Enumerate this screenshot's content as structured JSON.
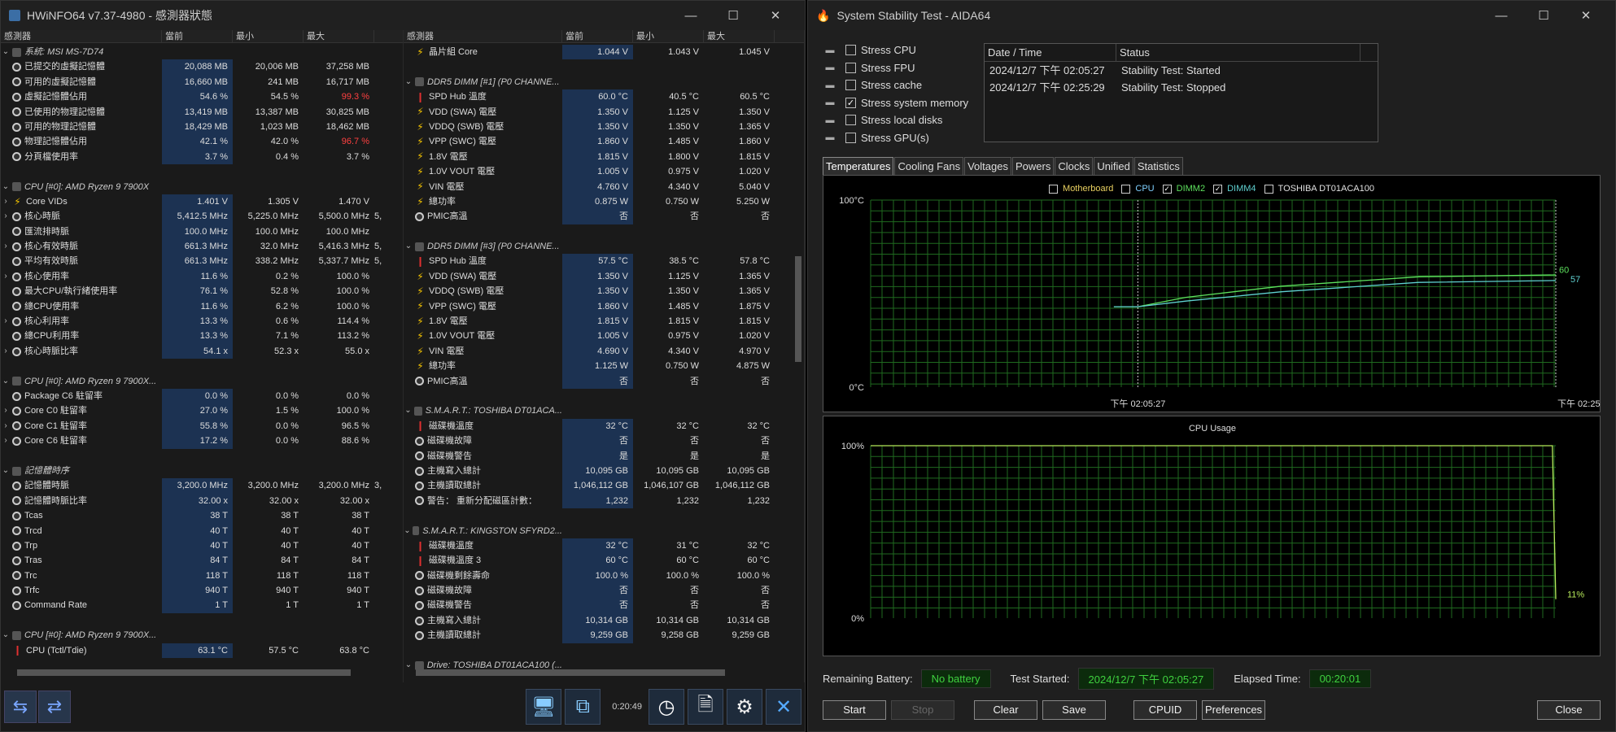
{
  "hwinfo": {
    "title": "HWiNFO64 v7.37-4980 - 感測器狀態",
    "columns": [
      "感測器",
      "當前",
      "最小",
      "最大"
    ],
    "left_rows": [
      {
        "type": "group",
        "name": "系統: MSI MS-7D74"
      },
      {
        "type": "row",
        "icon": "clock",
        "name": "已提交的虛擬記憶體",
        "cur": "20,088 MB",
        "min": "20,006 MB",
        "max": "37,258 MB"
      },
      {
        "type": "row",
        "icon": "clock",
        "name": "可用的虛擬記憶體",
        "cur": "16,660 MB",
        "min": "241 MB",
        "max": "16,717 MB"
      },
      {
        "type": "row",
        "icon": "clock",
        "name": "虛擬記憶體佔用",
        "cur": "54.6 %",
        "min": "54.5 %",
        "max": "99.3 %",
        "maxRed": true
      },
      {
        "type": "row",
        "icon": "clock",
        "name": "已使用的物理記憶體",
        "cur": "13,419 MB",
        "min": "13,387 MB",
        "max": "30,825 MB"
      },
      {
        "type": "row",
        "icon": "clock",
        "name": "可用的物理記憶體",
        "cur": "18,429 MB",
        "min": "1,023 MB",
        "max": "18,462 MB"
      },
      {
        "type": "row",
        "icon": "clock",
        "name": "物理記憶體佔用",
        "cur": "42.1 %",
        "min": "42.0 %",
        "max": "96.7 %",
        "maxRed": true
      },
      {
        "type": "row",
        "icon": "clock",
        "name": "分頁檔使用率",
        "cur": "3.7 %",
        "min": "0.4 %",
        "max": "3.7 %"
      },
      {
        "type": "blank"
      },
      {
        "type": "group",
        "name": "CPU [#0]: AMD Ryzen 9 7900X"
      },
      {
        "type": "row",
        "icon": "bolt",
        "exp": true,
        "name": "Core VIDs",
        "cur": "1.401 V",
        "min": "1.305 V",
        "max": "1.470 V"
      },
      {
        "type": "row",
        "icon": "clock",
        "exp": true,
        "name": "核心時脈",
        "cur": "5,412.5 MHz",
        "min": "5,225.0 MHz",
        "max": "5,500.0 MHz",
        "extra": "5,"
      },
      {
        "type": "row",
        "icon": "clock",
        "name": "匯流排時脈",
        "cur": "100.0 MHz",
        "min": "100.0 MHz",
        "max": "100.0 MHz"
      },
      {
        "type": "row",
        "icon": "clock",
        "exp": true,
        "name": "核心有效時脈",
        "cur": "661.3 MHz",
        "min": "32.0 MHz",
        "max": "5,416.3 MHz",
        "extra": "5,"
      },
      {
        "type": "row",
        "icon": "clock",
        "name": "平均有效時脈",
        "cur": "661.3 MHz",
        "min": "338.2 MHz",
        "max": "5,337.7 MHz",
        "extra": "5,"
      },
      {
        "type": "row",
        "icon": "clock",
        "exp": true,
        "name": "核心使用率",
        "cur": "11.6 %",
        "min": "0.2 %",
        "max": "100.0 %"
      },
      {
        "type": "row",
        "icon": "clock",
        "name": "最大CPU/執行緒使用率",
        "cur": "76.1 %",
        "min": "52.8 %",
        "max": "100.0 %"
      },
      {
        "type": "row",
        "icon": "clock",
        "name": "總CPU使用率",
        "cur": "11.6 %",
        "min": "6.2 %",
        "max": "100.0 %"
      },
      {
        "type": "row",
        "icon": "clock",
        "exp": true,
        "name": "核心利用率",
        "cur": "13.3 %",
        "min": "0.6 %",
        "max": "114.4 %"
      },
      {
        "type": "row",
        "icon": "clock",
        "name": "總CPU利用率",
        "cur": "13.3 %",
        "min": "7.1 %",
        "max": "113.2 %"
      },
      {
        "type": "row",
        "icon": "clock",
        "exp": true,
        "name": "核心時脈比率",
        "cur": "54.1 x",
        "min": "52.3 x",
        "max": "55.0 x"
      },
      {
        "type": "blank"
      },
      {
        "type": "group",
        "name": "CPU [#0]: AMD Ryzen 9 7900X..."
      },
      {
        "type": "row",
        "icon": "clock",
        "name": "Package C6 駐留率",
        "cur": "0.0 %",
        "min": "0.0 %",
        "max": "0.0 %"
      },
      {
        "type": "row",
        "icon": "clock",
        "exp": true,
        "name": "Core C0 駐留率",
        "cur": "27.0 %",
        "min": "1.5 %",
        "max": "100.0 %"
      },
      {
        "type": "row",
        "icon": "clock",
        "exp": true,
        "name": "Core C1 駐留率",
        "cur": "55.8 %",
        "min": "0.0 %",
        "max": "96.5 %"
      },
      {
        "type": "row",
        "icon": "clock",
        "exp": true,
        "name": "Core C6 駐留率",
        "cur": "17.2 %",
        "min": "0.0 %",
        "max": "88.6 %"
      },
      {
        "type": "blank"
      },
      {
        "type": "group",
        "name": "記憶體時序"
      },
      {
        "type": "row",
        "icon": "clock",
        "name": "記憶體時脈",
        "cur": "3,200.0 MHz",
        "min": "3,200.0 MHz",
        "max": "3,200.0 MHz",
        "extra": "3,"
      },
      {
        "type": "row",
        "icon": "clock",
        "name": "記憶體時脈比率",
        "cur": "32.00 x",
        "min": "32.00 x",
        "max": "32.00 x"
      },
      {
        "type": "row",
        "icon": "clock",
        "name": "Tcas",
        "cur": "38 T",
        "min": "38 T",
        "max": "38 T"
      },
      {
        "type": "row",
        "icon": "clock",
        "name": "Trcd",
        "cur": "40 T",
        "min": "40 T",
        "max": "40 T"
      },
      {
        "type": "row",
        "icon": "clock",
        "name": "Trp",
        "cur": "40 T",
        "min": "40 T",
        "max": "40 T"
      },
      {
        "type": "row",
        "icon": "clock",
        "name": "Tras",
        "cur": "84 T",
        "min": "84 T",
        "max": "84 T"
      },
      {
        "type": "row",
        "icon": "clock",
        "name": "Trc",
        "cur": "118 T",
        "min": "118 T",
        "max": "118 T"
      },
      {
        "type": "row",
        "icon": "clock",
        "name": "Trfc",
        "cur": "940 T",
        "min": "940 T",
        "max": "940 T"
      },
      {
        "type": "row",
        "icon": "clock",
        "name": "Command Rate",
        "cur": "1 T",
        "min": "1 T",
        "max": "1 T"
      },
      {
        "type": "blank"
      },
      {
        "type": "group",
        "name": "CPU [#0]: AMD Ryzen 9 7900X..."
      },
      {
        "type": "row",
        "icon": "therm",
        "name": "CPU (Tctl/Tdie)",
        "cur": "63.1 °C",
        "min": "57.5 °C",
        "max": "63.8 °C"
      }
    ],
    "right_rows": [
      {
        "type": "row",
        "icon": "bolt",
        "name": "晶片組 Core",
        "cur": "1.044 V",
        "min": "1.043 V",
        "max": "1.045 V"
      },
      {
        "type": "blank"
      },
      {
        "type": "group",
        "name": "DDR5 DIMM [#1] (P0 CHANNE..."
      },
      {
        "type": "row",
        "icon": "therm",
        "name": "SPD Hub 溫度",
        "cur": "60.0 °C",
        "min": "40.5 °C",
        "max": "60.5 °C"
      },
      {
        "type": "row",
        "icon": "bolt",
        "name": "VDD (SWA) 電壓",
        "cur": "1.350 V",
        "min": "1.125 V",
        "max": "1.350 V"
      },
      {
        "type": "row",
        "icon": "bolt",
        "name": "VDDQ (SWB) 電壓",
        "cur": "1.350 V",
        "min": "1.350 V",
        "max": "1.365 V"
      },
      {
        "type": "row",
        "icon": "bolt",
        "name": "VPP (SWC) 電壓",
        "cur": "1.860 V",
        "min": "1.485 V",
        "max": "1.860 V"
      },
      {
        "type": "row",
        "icon": "bolt",
        "name": "1.8V 電壓",
        "cur": "1.815 V",
        "min": "1.800 V",
        "max": "1.815 V"
      },
      {
        "type": "row",
        "icon": "bolt",
        "name": "1.0V VOUT 電壓",
        "cur": "1.005 V",
        "min": "0.975 V",
        "max": "1.020 V"
      },
      {
        "type": "row",
        "icon": "bolt",
        "name": "VIN 電壓",
        "cur": "4.760 V",
        "min": "4.340 V",
        "max": "5.040 V"
      },
      {
        "type": "row",
        "icon": "bolt",
        "name": "總功率",
        "cur": "0.875 W",
        "min": "0.750 W",
        "max": "5.250 W"
      },
      {
        "type": "row",
        "icon": "clock",
        "name": "PMIC高溫",
        "cur": "否",
        "min": "否",
        "max": "否"
      },
      {
        "type": "blank"
      },
      {
        "type": "group",
        "name": "DDR5 DIMM [#3] (P0 CHANNE..."
      },
      {
        "type": "row",
        "icon": "therm",
        "name": "SPD Hub 溫度",
        "cur": "57.5 °C",
        "min": "38.5 °C",
        "max": "57.8 °C"
      },
      {
        "type": "row",
        "icon": "bolt",
        "name": "VDD (SWA) 電壓",
        "cur": "1.350 V",
        "min": "1.125 V",
        "max": "1.365 V"
      },
      {
        "type": "row",
        "icon": "bolt",
        "name": "VDDQ (SWB) 電壓",
        "cur": "1.350 V",
        "min": "1.350 V",
        "max": "1.365 V"
      },
      {
        "type": "row",
        "icon": "bolt",
        "name": "VPP (SWC) 電壓",
        "cur": "1.860 V",
        "min": "1.485 V",
        "max": "1.875 V"
      },
      {
        "type": "row",
        "icon": "bolt",
        "name": "1.8V 電壓",
        "cur": "1.815 V",
        "min": "1.815 V",
        "max": "1.815 V"
      },
      {
        "type": "row",
        "icon": "bolt",
        "name": "1.0V VOUT 電壓",
        "cur": "1.005 V",
        "min": "0.975 V",
        "max": "1.020 V"
      },
      {
        "type": "row",
        "icon": "bolt",
        "name": "VIN 電壓",
        "cur": "4.690 V",
        "min": "4.340 V",
        "max": "4.970 V"
      },
      {
        "type": "row",
        "icon": "bolt",
        "name": "總功率",
        "cur": "1.125 W",
        "min": "0.750 W",
        "max": "4.875 W"
      },
      {
        "type": "row",
        "icon": "clock",
        "name": "PMIC高溫",
        "cur": "否",
        "min": "否",
        "max": "否"
      },
      {
        "type": "blank"
      },
      {
        "type": "group",
        "name": "S.M.A.R.T.: TOSHIBA DT01ACA..."
      },
      {
        "type": "row",
        "icon": "therm",
        "name": "磁碟機溫度",
        "cur": "32 °C",
        "min": "32 °C",
        "max": "32 °C"
      },
      {
        "type": "row",
        "icon": "clock",
        "name": "磁碟機故障",
        "cur": "否",
        "min": "否",
        "max": "否"
      },
      {
        "type": "row",
        "icon": "clock",
        "name": "磁碟機警告",
        "cur": "是",
        "min": "是",
        "max": "是"
      },
      {
        "type": "row",
        "icon": "clock",
        "name": "主機寫入總計",
        "cur": "10,095 GB",
        "min": "10,095 GB",
        "max": "10,095 GB"
      },
      {
        "type": "row",
        "icon": "clock",
        "name": "主機讀取總計",
        "cur": "1,046,112 GB",
        "min": "1,046,107 GB",
        "max": "1,046,112 GB"
      },
      {
        "type": "row",
        "icon": "clock",
        "name": "警告： 重新分配磁區計數：",
        "cur": "1,232",
        "min": "1,232",
        "max": "1,232"
      },
      {
        "type": "blank"
      },
      {
        "type": "group",
        "name": "S.M.A.R.T.: KINGSTON SFYRD2..."
      },
      {
        "type": "row",
        "icon": "therm",
        "name": "磁碟機溫度",
        "cur": "32 °C",
        "min": "31 °C",
        "max": "32 °C"
      },
      {
        "type": "row",
        "icon": "therm",
        "name": "磁碟機溫度 3",
        "cur": "60 °C",
        "min": "60 °C",
        "max": "60 °C"
      },
      {
        "type": "row",
        "icon": "clock",
        "name": "磁碟機剩餘壽命",
        "cur": "100.0 %",
        "min": "100.0 %",
        "max": "100.0 %"
      },
      {
        "type": "row",
        "icon": "clock",
        "name": "磁碟機故障",
        "cur": "否",
        "min": "否",
        "max": "否"
      },
      {
        "type": "row",
        "icon": "clock",
        "name": "磁碟機警告",
        "cur": "否",
        "min": "否",
        "max": "否"
      },
      {
        "type": "row",
        "icon": "clock",
        "name": "主機寫入總計",
        "cur": "10,314 GB",
        "min": "10,314 GB",
        "max": "10,314 GB"
      },
      {
        "type": "row",
        "icon": "clock",
        "name": "主機讀取總計",
        "cur": "9,259 GB",
        "min": "9,258 GB",
        "max": "9,259 GB"
      },
      {
        "type": "blank"
      },
      {
        "type": "group",
        "name": "Drive: TOSHIBA DT01ACA100 (..."
      }
    ],
    "time": "0:20:49"
  },
  "aida": {
    "title": "System Stability Test - AIDA64",
    "stress": [
      {
        "label": "Stress CPU",
        "checked": false
      },
      {
        "label": "Stress FPU",
        "checked": false
      },
      {
        "label": "Stress cache",
        "checked": false
      },
      {
        "label": "Stress system memory",
        "checked": true
      },
      {
        "label": "Stress local disks",
        "checked": false
      },
      {
        "label": "Stress GPU(s)",
        "checked": false
      }
    ],
    "log_headers": [
      "Date / Time",
      "Status"
    ],
    "log": [
      {
        "time": "2024/12/7 下午 02:05:27",
        "status": "Stability Test: Started"
      },
      {
        "time": "2024/12/7 下午 02:25:29",
        "status": "Stability Test: Stopped"
      }
    ],
    "tabs": [
      "Temperatures",
      "Cooling Fans",
      "Voltages",
      "Powers",
      "Clocks",
      "Unified",
      "Statistics"
    ],
    "active_tab": "Temperatures",
    "legend": [
      {
        "label": "Motherboard",
        "checked": false,
        "color": "#e8d060"
      },
      {
        "label": "CPU",
        "checked": false,
        "color": "#7fd0ff"
      },
      {
        "label": "DIMM2",
        "checked": true,
        "color": "#5de05d"
      },
      {
        "label": "DIMM4",
        "checked": true,
        "color": "#5fd0d0"
      },
      {
        "label": "TOSHIBA DT01ACA100",
        "checked": false,
        "color": "#e0e0e0"
      }
    ],
    "temp_graph": {
      "ymax": "100°C",
      "ymin": "0°C",
      "xlabel_start": "下午 02:05:27",
      "xlabel_end": "下午 02:25",
      "val_dimm2": "60",
      "val_dimm4": "57"
    },
    "cpu_graph": {
      "title": "CPU Usage",
      "ymax": "100%",
      "ymin": "0%",
      "val": "11%"
    },
    "status": {
      "battery_label": "Remaining Battery:",
      "battery": "No battery",
      "started_label": "Test Started:",
      "started": "2024/12/7 下午 02:05:27",
      "elapsed_label": "Elapsed Time:",
      "elapsed": "00:20:01"
    },
    "buttons": {
      "start": "Start",
      "stop": "Stop",
      "clear": "Clear",
      "save": "Save",
      "cpuid": "CPUID",
      "preferences": "Preferences",
      "close": "Close"
    }
  },
  "chart_data": [
    {
      "type": "line",
      "title": "",
      "ylabel": "°C",
      "ylim": [
        0,
        100
      ],
      "x": [
        "下午 02:05:27",
        "",
        "",
        "",
        "",
        "下午 02:25"
      ],
      "series": [
        {
          "name": "DIMM2",
          "values": [
            43,
            43,
            48,
            54,
            59,
            60
          ]
        },
        {
          "name": "DIMM4",
          "values": [
            43,
            43,
            46,
            51,
            56,
            57
          ]
        }
      ]
    },
    {
      "type": "line",
      "title": "CPU Usage",
      "ylim": [
        0,
        100
      ],
      "series": [
        {
          "name": "",
          "values": [
            100,
            100,
            100,
            100,
            100,
            11
          ]
        }
      ]
    }
  ]
}
